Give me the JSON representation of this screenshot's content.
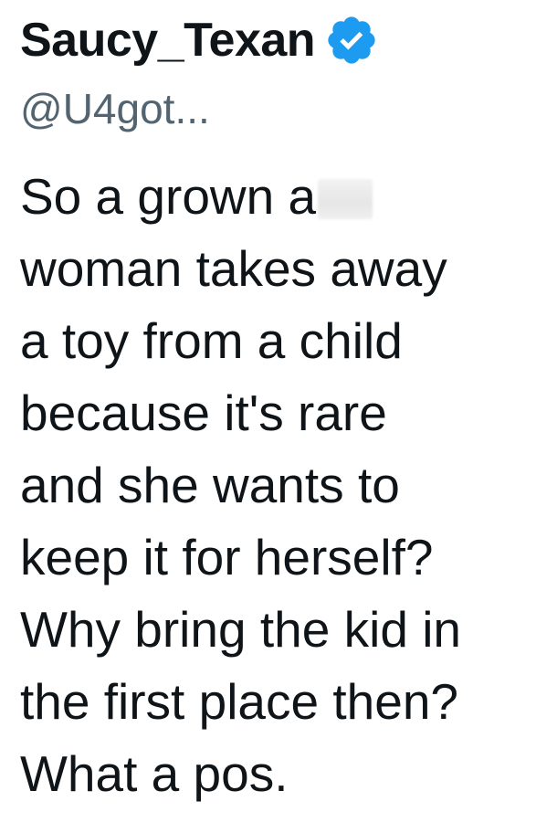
{
  "user": {
    "display_name": "Saucy_Texan",
    "handle": "@U4got...",
    "verified_icon": "verified-check-icon",
    "badge_color": "#1d9bf0"
  },
  "tweet": {
    "line1": "So a grown a",
    "body_rest": "woman takes away\na toy from a child\nbecause it's rare\nand she wants to\nkeep it for herself?\nWhy bring the kid in\nthe first place then?\nWhat a pos."
  }
}
